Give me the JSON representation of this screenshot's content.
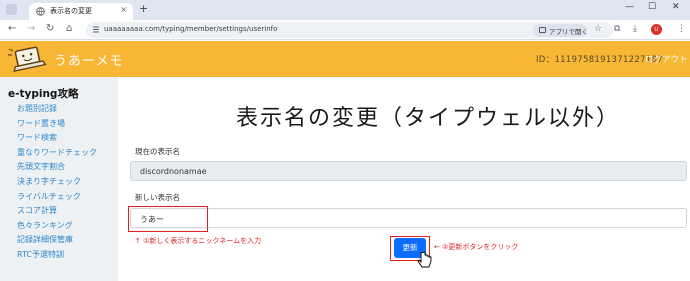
{
  "browser": {
    "tab_title": "表示名の変更",
    "tab_close": "×",
    "new_tab": "+",
    "url": "uaaaaaaaa.com/typing/member/settings/userinfo",
    "open_in_app": "アプリで開く",
    "profile_initial": "U"
  },
  "header": {
    "site_title": "うあーメモ",
    "user_id": "ID：1119758191371227187",
    "logout": "ログアウト"
  },
  "sidebar": {
    "heading": "e-typing攻略",
    "items": [
      "お題別記録",
      "ワード置き場",
      "ワード検索",
      "重なりワードチェック",
      "先頭文字割合",
      "決まり字チェック",
      "ライバルチェック",
      "スコア計算",
      "色々ランキング",
      "記録詳細保管庫",
      "RTC予選特訓"
    ]
  },
  "main": {
    "title": "表示名の変更（タイプウェル以外）",
    "current_label": "現在の表示名",
    "current_value": "discordnonamae",
    "new_label": "新しい表示名",
    "new_value": "うあー",
    "update_button": "更新"
  },
  "annotations": {
    "input_note": "↑ ①新しく表示するニックネームを入力",
    "button_note": "← ②更新ボタンをクリック",
    "color": "#e02020"
  },
  "colors": {
    "header_bg": "#f7b633",
    "sidebar_bg": "#eef1f4",
    "link": "#2f86c8",
    "primary": "#0d6efd"
  }
}
